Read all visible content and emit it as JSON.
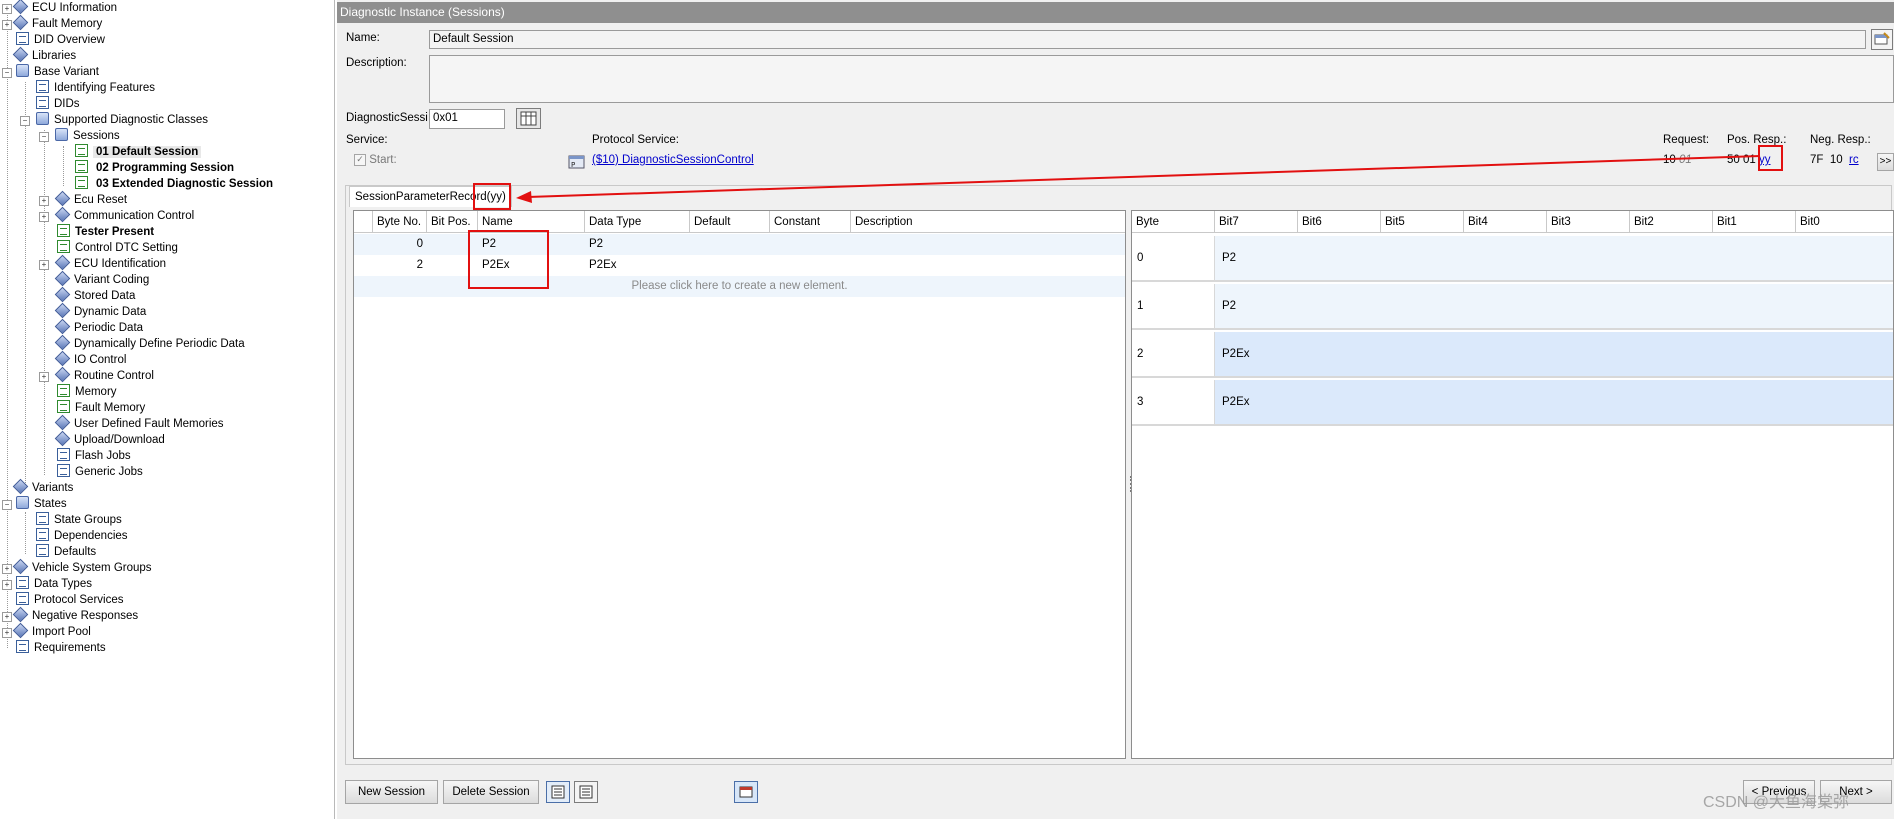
{
  "tree": {
    "items": [
      {
        "label": "ECU Information"
      },
      {
        "label": "Fault Memory"
      },
      {
        "label": "DID Overview"
      },
      {
        "label": "Libraries"
      },
      {
        "label": "Base Variant"
      },
      {
        "label": "Identifying Features"
      },
      {
        "label": "DIDs"
      },
      {
        "label": "Supported Diagnostic Classes"
      },
      {
        "label": "Sessions"
      },
      {
        "label": "01 Default Session"
      },
      {
        "label": "02 Programming Session"
      },
      {
        "label": "03 Extended Diagnostic Session"
      },
      {
        "label": "Ecu Reset"
      },
      {
        "label": "Communication Control"
      },
      {
        "label": "Tester Present"
      },
      {
        "label": "Control DTC Setting"
      },
      {
        "label": "ECU Identification"
      },
      {
        "label": "Variant Coding"
      },
      {
        "label": "Stored Data"
      },
      {
        "label": "Dynamic Data"
      },
      {
        "label": "Periodic Data"
      },
      {
        "label": "Dynamically Define Periodic Data"
      },
      {
        "label": "IO Control"
      },
      {
        "label": "Routine Control"
      },
      {
        "label": "Memory"
      },
      {
        "label": "Fault Memory"
      },
      {
        "label": "User Defined Fault Memories"
      },
      {
        "label": "Upload/Download"
      },
      {
        "label": "Flash Jobs"
      },
      {
        "label": "Generic Jobs"
      },
      {
        "label": "Variants"
      },
      {
        "label": "States"
      },
      {
        "label": "State Groups"
      },
      {
        "label": "Dependencies"
      },
      {
        "label": "Defaults"
      },
      {
        "label": "Vehicle System Groups"
      },
      {
        "label": "Data Types"
      },
      {
        "label": "Protocol Services"
      },
      {
        "label": "Negative Responses"
      },
      {
        "label": "Import Pool"
      },
      {
        "label": "Requirements"
      }
    ]
  },
  "panel": {
    "title": "Diagnostic Instance (Sessions)",
    "name_label": "Name:",
    "name_value": "Default Session",
    "description_label": "Description:",
    "description_value": "",
    "session_label": "DiagnosticSessi",
    "session_value": "0x01",
    "service_label": "Service:",
    "start_label": "Start:",
    "protocol_service_label": "Protocol Service:",
    "protocol_service_link": "($10) DiagnosticSessionControl",
    "request_label": "Request:",
    "request_bytes": "10",
    "request_param": "01",
    "pos_resp_label": "Pos. Resp.:",
    "pos_resp_bytes": "50",
    "pos_resp_param": "01",
    "pos_resp_link": "yy",
    "neg_resp_label": "Neg. Resp.:",
    "neg_resp_bytes": "7F",
    "neg_resp_byte2": "10",
    "neg_resp_link": "rc",
    "more_label": ">>",
    "tab_label": "SessionParameterRecord",
    "tab_suffix": "(yy)"
  },
  "param_table": {
    "columns": [
      "Byte No.",
      "Bit Pos.",
      "Name",
      "Data Type",
      "Default",
      "Constant",
      "Description"
    ],
    "rows": [
      {
        "byte": "0",
        "bit": "",
        "name": "P2",
        "type": "P2"
      },
      {
        "byte": "2",
        "bit": "",
        "name": "P2Ex",
        "type": "P2Ex"
      }
    ],
    "new_element_hint": "Please click here to create a new element."
  },
  "byte_table": {
    "columns": [
      "Byte",
      "Bit7",
      "Bit6",
      "Bit5",
      "Bit4",
      "Bit3",
      "Bit2",
      "Bit1",
      "Bit0"
    ],
    "rows": [
      {
        "byte": "0",
        "name": "P2"
      },
      {
        "byte": "1",
        "name": "P2"
      },
      {
        "byte": "2",
        "name": "P2Ex"
      },
      {
        "byte": "3",
        "name": "P2Ex"
      }
    ]
  },
  "footer": {
    "new_session": "New Session",
    "delete_session": "Delete Session",
    "previous": "< Previous",
    "next": "Next >",
    "watermark": "CSDN @大鱼海棠弥"
  },
  "colors": {
    "accent_red": "#e21010",
    "link_blue": "#0000cc",
    "row_highlight": "#dbe9fb",
    "row_alt": "#eef5fc"
  }
}
